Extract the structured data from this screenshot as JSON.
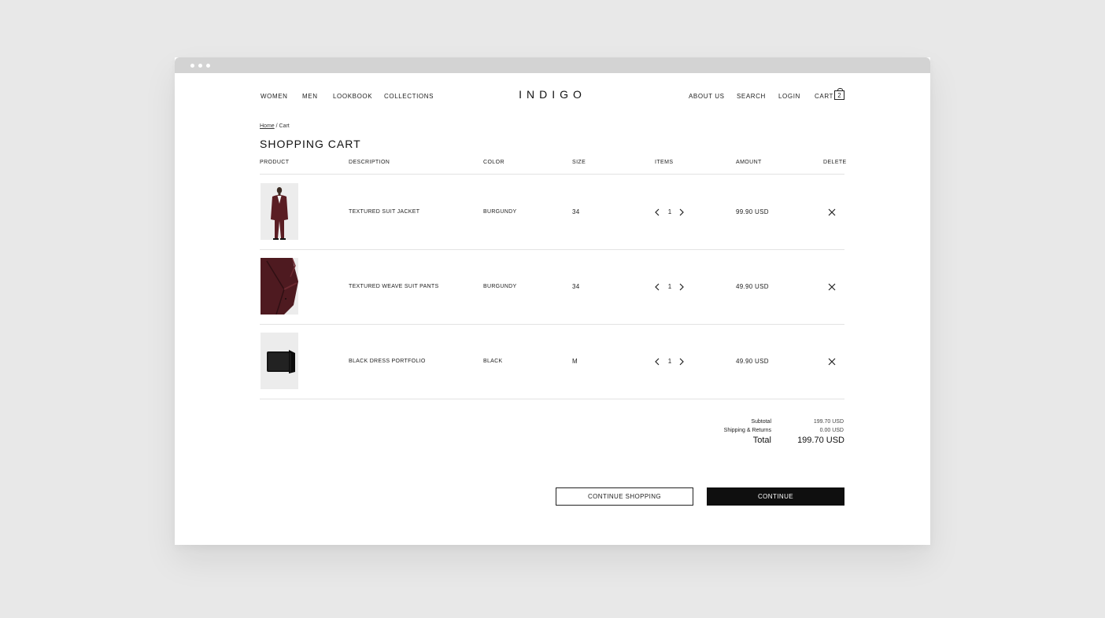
{
  "nav": {
    "left": [
      "WOMEN",
      "MEN",
      "LOOKBOOK",
      "COLLECTIONS"
    ],
    "logo": "INDIGO",
    "right": [
      "ABOUT US",
      "SEARCH",
      "LOGIN",
      "CART"
    ],
    "cart_count": "2"
  },
  "breadcrumb": {
    "home": "Home",
    "separator": " / ",
    "current": "Cart"
  },
  "page_title": "SHOPPING CART",
  "columns": [
    "PRODUCT",
    "DESCRIPTION",
    "COLOR",
    "SIZE",
    "ITEMS",
    "AMOUNT",
    "DELETE"
  ],
  "items": [
    {
      "description": "TEXTURED SUIT JACKET",
      "color": "BURGUNDY",
      "size": "34",
      "quantity": "1",
      "amount": "99.90 USD",
      "image": "burgundy-suit-jacket-photo"
    },
    {
      "description": "TEXTURED WEAVE SUIT PANTS",
      "color": "BURGUNDY",
      "size": "34",
      "quantity": "1",
      "amount": "49.90 USD",
      "image": "burgundy-suit-pants-photo"
    },
    {
      "description": "BLACK DRESS PORTFOLIO",
      "color": "BLACK",
      "size": "M",
      "quantity": "1",
      "amount": "49.90 USD",
      "image": "black-portfolio-photo"
    }
  ],
  "summary": {
    "subtotal_label": "Subtotal",
    "subtotal_value": "199.70  USD",
    "shipping_label": "Shipping & Returns",
    "shipping_value": "0.00  USD",
    "total_label": "Total",
    "total_value": "199.70 USD"
  },
  "buttons": {
    "continue_shopping": "CONTINUE SHOPPING",
    "continue": "CONTINUE"
  },
  "icons": {
    "qty_decrease": "chevron-left-icon",
    "qty_increase": "chevron-right-icon",
    "delete": "close-icon"
  },
  "colors": {
    "burgundy": "#5a1d23",
    "button_dark": "#0f0f0f",
    "page_bg": "#e8e8e8",
    "titlebar": "#d3d3d3"
  }
}
